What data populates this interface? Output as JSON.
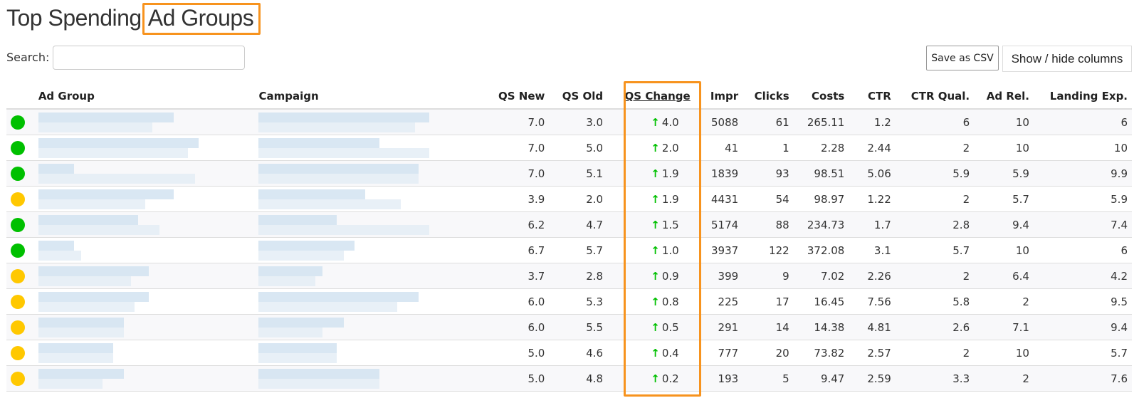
{
  "header": {
    "title_prefix": "Top Spending",
    "title_highlight": "Ad Groups"
  },
  "search": {
    "label": "Search:",
    "value": "",
    "placeholder": ""
  },
  "toolbar": {
    "save_csv_label": "Save as CSV",
    "show_hide_label": "Show / hide columns"
  },
  "colors": {
    "highlight": "#f7931e",
    "status_good": "#00c000",
    "status_warn": "#ffc800",
    "up_arrow": "#00c000"
  },
  "table": {
    "columns": [
      "",
      "Ad Group",
      "Campaign",
      "QS New",
      "QS Old",
      "QS Change",
      "Impr",
      "Clicks",
      "Costs",
      "CTR",
      "CTR Qual.",
      "Ad Rel.",
      "Landing Exp."
    ],
    "sorted_column": "QS Change",
    "rows": [
      {
        "status": "green",
        "qs_new": "7.0",
        "qs_old": "3.0",
        "qs_change": "4.0",
        "impr": "5088",
        "clicks": "61",
        "costs": "265.11",
        "ctr": "1.2",
        "ctr_qual": "6",
        "ad_rel": "10",
        "landing_exp": "6"
      },
      {
        "status": "green",
        "qs_new": "7.0",
        "qs_old": "5.0",
        "qs_change": "2.0",
        "impr": "41",
        "clicks": "1",
        "costs": "2.28",
        "ctr": "2.44",
        "ctr_qual": "2",
        "ad_rel": "10",
        "landing_exp": "10"
      },
      {
        "status": "green",
        "qs_new": "7.0",
        "qs_old": "5.1",
        "qs_change": "1.9",
        "impr": "1839",
        "clicks": "93",
        "costs": "98.51",
        "ctr": "5.06",
        "ctr_qual": "5.9",
        "ad_rel": "5.9",
        "landing_exp": "9.9"
      },
      {
        "status": "yellow",
        "qs_new": "3.9",
        "qs_old": "2.0",
        "qs_change": "1.9",
        "impr": "4431",
        "clicks": "54",
        "costs": "98.97",
        "ctr": "1.22",
        "ctr_qual": "2",
        "ad_rel": "5.7",
        "landing_exp": "5.9"
      },
      {
        "status": "green",
        "qs_new": "6.2",
        "qs_old": "4.7",
        "qs_change": "1.5",
        "impr": "5174",
        "clicks": "88",
        "costs": "234.73",
        "ctr": "1.7",
        "ctr_qual": "2.8",
        "ad_rel": "9.4",
        "landing_exp": "7.4"
      },
      {
        "status": "green",
        "qs_new": "6.7",
        "qs_old": "5.7",
        "qs_change": "1.0",
        "impr": "3937",
        "clicks": "122",
        "costs": "372.08",
        "ctr": "3.1",
        "ctr_qual": "5.7",
        "ad_rel": "10",
        "landing_exp": "6"
      },
      {
        "status": "yellow",
        "qs_new": "3.7",
        "qs_old": "2.8",
        "qs_change": "0.9",
        "impr": "399",
        "clicks": "9",
        "costs": "7.02",
        "ctr": "2.26",
        "ctr_qual": "2",
        "ad_rel": "6.4",
        "landing_exp": "4.2"
      },
      {
        "status": "yellow",
        "qs_new": "6.0",
        "qs_old": "5.3",
        "qs_change": "0.8",
        "impr": "225",
        "clicks": "17",
        "costs": "16.45",
        "ctr": "7.56",
        "ctr_qual": "5.8",
        "ad_rel": "2",
        "landing_exp": "9.5"
      },
      {
        "status": "yellow",
        "qs_new": "6.0",
        "qs_old": "5.5",
        "qs_change": "0.5",
        "impr": "291",
        "clicks": "14",
        "costs": "14.38",
        "ctr": "4.81",
        "ctr_qual": "2.6",
        "ad_rel": "7.1",
        "landing_exp": "9.4"
      },
      {
        "status": "yellow",
        "qs_new": "5.0",
        "qs_old": "4.6",
        "qs_change": "0.4",
        "impr": "777",
        "clicks": "20",
        "costs": "73.82",
        "ctr": "2.57",
        "ctr_qual": "2",
        "ad_rel": "10",
        "landing_exp": "5.7"
      },
      {
        "status": "yellow",
        "qs_new": "5.0",
        "qs_old": "4.8",
        "qs_change": "0.2",
        "impr": "193",
        "clicks": "5",
        "costs": "9.47",
        "ctr": "2.59",
        "ctr_qual": "3.3",
        "ad_rel": "2",
        "landing_exp": "7.6"
      }
    ]
  }
}
